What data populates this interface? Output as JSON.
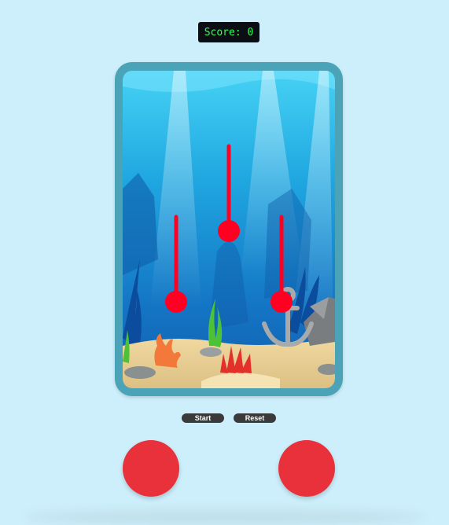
{
  "score": {
    "label": "Score:",
    "value": "0",
    "text": "Score: 0"
  },
  "controls": {
    "start_label": "Start",
    "reset_label": "Reset"
  },
  "game": {
    "pendulums": [
      {
        "id": "left"
      },
      {
        "id": "middle"
      },
      {
        "id": "right"
      }
    ],
    "colors": {
      "pendulum": "#ff0022",
      "button": "#e8313a",
      "frame": "#4aa3b6",
      "background": "#cdeffb"
    },
    "scene_icons": [
      "coral-icon",
      "seaweed-icon",
      "anchor-icon",
      "rock-icon",
      "light-ray-icon"
    ]
  }
}
